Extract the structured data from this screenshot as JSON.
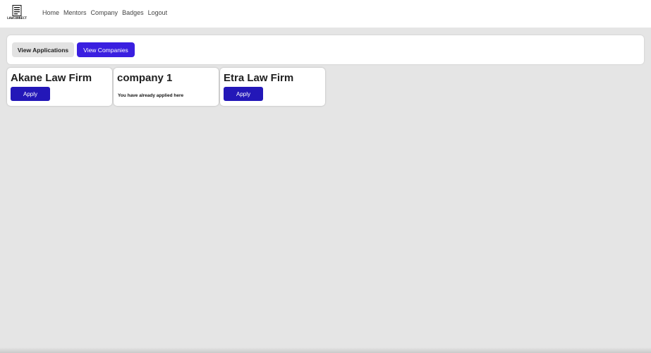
{
  "brand": {
    "logo_text": "LAWCONNECT",
    "logo_icon": "document-icon"
  },
  "nav": {
    "items": [
      {
        "label": "Home"
      },
      {
        "label": "Mentors"
      },
      {
        "label": "Company"
      },
      {
        "label": "Badges"
      },
      {
        "label": "Logout"
      }
    ]
  },
  "toolbar": {
    "view_applications_label": "View Applications",
    "view_companies_label": "View Companies"
  },
  "companies": [
    {
      "name": "Akane Law Firm",
      "action_label": "Apply",
      "applied": false
    },
    {
      "name": "company 1",
      "status_text": "You have already applied here",
      "applied": true
    },
    {
      "name": "Etra Law Firm",
      "action_label": "Apply",
      "applied": false
    }
  ],
  "colors": {
    "primary_button": "#3a1fe0",
    "apply_button": "#2317b8",
    "background": "#e5e5e5",
    "secondary_button": "#e2e2e2"
  }
}
